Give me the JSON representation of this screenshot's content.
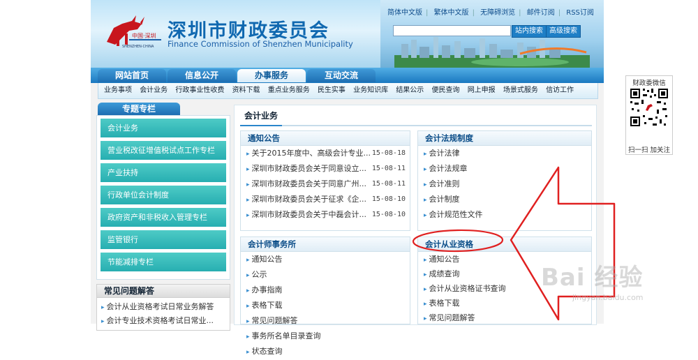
{
  "header": {
    "site_name_cn": "深圳市财政委员会",
    "site_name_en": "Finance Commission of Shenzhen Municipality",
    "logo_caption": "中国·深圳",
    "logo_caption_en": "SHENZHEN·CHINA",
    "top_links": [
      "简体中文版",
      "繁体中文版",
      "无障碍浏览",
      "邮件订阅",
      "RSS订阅"
    ],
    "search_placeholder": "",
    "search_site_button": "站内搜索",
    "search_advanced_button": "高级搜索"
  },
  "nav": {
    "items": [
      {
        "label": "网站首页",
        "active": false
      },
      {
        "label": "信息公开",
        "active": false
      },
      {
        "label": "办事服务",
        "active": true
      },
      {
        "label": "互动交流",
        "active": false
      }
    ]
  },
  "subnav": {
    "items": [
      "业务事项",
      "会计业务",
      "行政事业性收费",
      "资料下载",
      "重点业务服务",
      "民生实事",
      "业务知识库",
      "结果公示",
      "便民查询",
      "网上申报",
      "场景式服务",
      "信访工作"
    ]
  },
  "sidebar": {
    "title": "专题专栏",
    "items": [
      "会计业务",
      "营业税改征增值税试点工作专栏",
      "产业扶持",
      "行政单位会计制度",
      "政府资产和非税收入管理专栏",
      "监管银行",
      "节能减排专栏"
    ]
  },
  "faq": {
    "title": "常见问题解答",
    "items": [
      "会计从业资格考试日常业务解答",
      "会计专业技术资格考试日常业..."
    ]
  },
  "main": {
    "title": "会计业务",
    "notices": {
      "title": "通知公告",
      "items": [
        {
          "text": "关于2015年度中、高级会计专业...",
          "date": "15-08-18"
        },
        {
          "text": "深圳市财政委员会关于同意设立...",
          "date": "15-08-11"
        },
        {
          "text": "深圳市财政委员会关于同意广州...",
          "date": "15-08-11"
        },
        {
          "text": "深圳市财政委员会关于征求《企...",
          "date": "15-08-10"
        },
        {
          "text": "深圳市财政委员会关于中磊会计...",
          "date": "15-08-10"
        }
      ]
    },
    "laws": {
      "title": "会计法规制度",
      "items": [
        "会计法律",
        "会计法规章",
        "会计准则",
        "会计制度",
        "会计规范性文件"
      ]
    },
    "firms": {
      "title": "会计师事务所",
      "items": [
        "通知公告",
        "公示",
        "办事指南",
        "表格下载",
        "常见问题解答",
        "事务所名单目录查询",
        "状态查询"
      ]
    },
    "qualification": {
      "title": "会计从业资格",
      "items": [
        "通知公告",
        "成绩查询",
        "会计从业资格证书查询",
        "表格下载",
        "常见问题解答"
      ]
    }
  },
  "qr": {
    "title": "财政委微信",
    "caption": "扫一扫 加关注"
  },
  "watermark": {
    "logo_text": "Bai 经验",
    "url": "jingyan.baidu.com"
  },
  "colors": {
    "nav_blue": "#1a78c0",
    "sidebar_teal": "#27aeb1",
    "annotation_red": "#e02020",
    "link_blue": "#0b4d88"
  }
}
